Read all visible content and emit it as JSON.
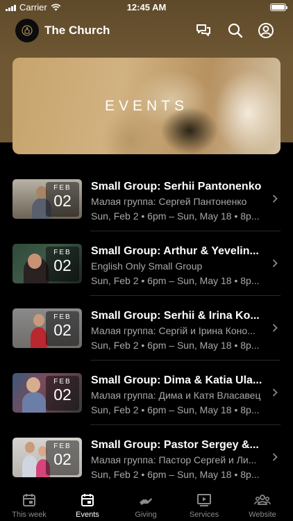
{
  "status_bar": {
    "carrier": "Carrier",
    "time": "12:45 AM"
  },
  "header": {
    "title": "The Church"
  },
  "hero": {
    "title": "EVENTS"
  },
  "events": [
    {
      "title": "Small Group:  Serhii Pantonenko",
      "subtitle": "Малая группа: Сергей Пантоненко",
      "when": "Sun, Feb 2 • 6pm – Sun, May 18 • 8p...",
      "month": "FEB",
      "day": "02"
    },
    {
      "title": "Small Group:  Arthur & Yevelin...",
      "subtitle": "English Only Small Group",
      "when": "Sun, Feb 2 • 6pm – Sun, May 18 • 8p...",
      "month": "FEB",
      "day": "02"
    },
    {
      "title": "Small Group:  Serhii & Irina Ko...",
      "subtitle": "Малая группа: Сергій и Ірина Коно...",
      "when": "Sun, Feb 2 • 6pm – Sun, May 18 • 8p...",
      "month": "FEB",
      "day": "02"
    },
    {
      "title": "Small Group:  Dima & Katia Ula...",
      "subtitle": "Малая группа: Дима и Катя Власавец",
      "when": "Sun, Feb 2 • 6pm – Sun, May 18 • 8p...",
      "month": "FEB",
      "day": "02"
    },
    {
      "title": "Small Group:  Pastor Sergey &...",
      "subtitle": "Малая группа: Пастор Сергей и Ли...",
      "when": "Sun, Feb 2 • 6pm – Sun, May 18 • 8p...",
      "month": "FEB",
      "day": "02"
    }
  ],
  "tabs": [
    {
      "label": "This week",
      "icon": "calendar-icon",
      "active": false
    },
    {
      "label": "Events",
      "icon": "calendar-icon",
      "active": true
    },
    {
      "label": "Giving",
      "icon": "giving-hand-icon",
      "active": false
    },
    {
      "label": "Services",
      "icon": "play-video-icon",
      "active": false
    },
    {
      "label": "Website",
      "icon": "people-group-icon",
      "active": false
    }
  ],
  "colors": {
    "brand_brown": "#6f5733",
    "background": "#000000",
    "muted_text": "#a8a8a8",
    "inactive_tab": "#8a8a8a"
  }
}
